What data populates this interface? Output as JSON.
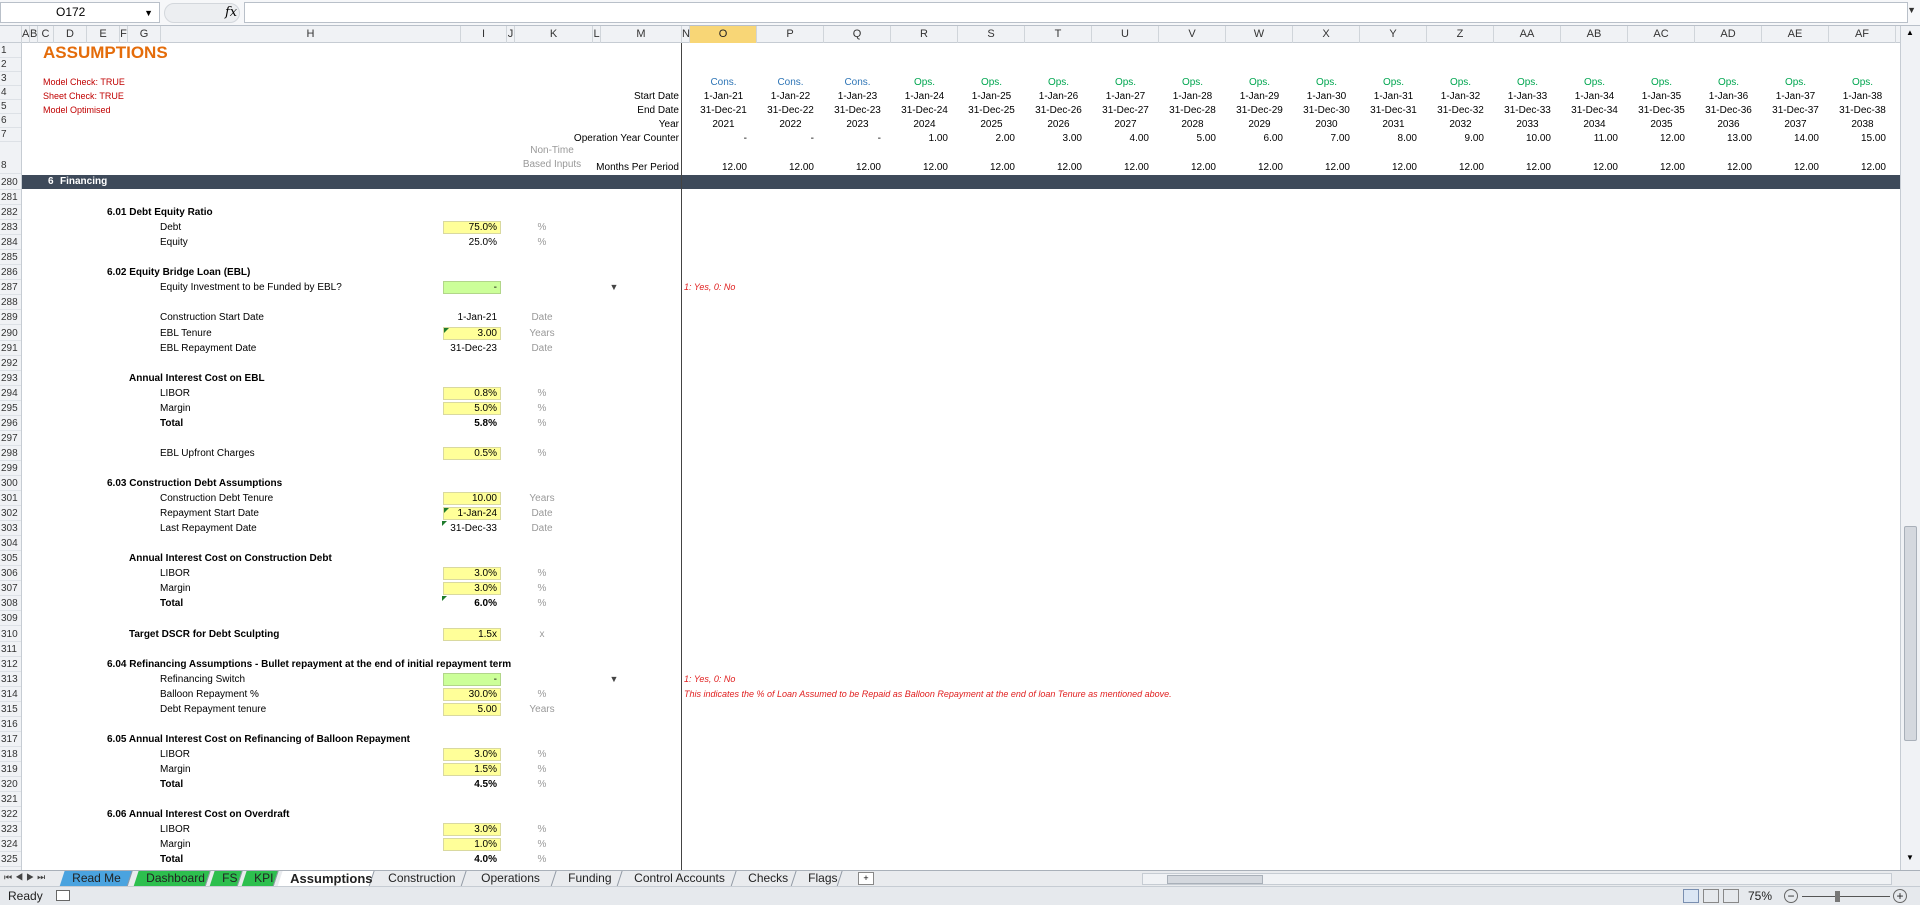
{
  "name_box": "O172",
  "fx_label": "fx",
  "columns": [
    "A",
    "B",
    "C",
    "D",
    "E",
    "F",
    "G",
    "H",
    "I",
    "J",
    "K",
    "L",
    "M",
    "N",
    "O",
    "P",
    "Q",
    "R",
    "S",
    "T",
    "U",
    "V",
    "W",
    "X",
    "Y",
    "Z",
    "AA",
    "AB",
    "AC",
    "AD",
    "AE",
    "AF"
  ],
  "selected_column": "O",
  "row_numbers": [
    "1",
    "2",
    "3",
    "4",
    "5",
    "6",
    "7",
    "8",
    "280",
    "281",
    "282",
    "283",
    "284",
    "285",
    "286",
    "287",
    "288",
    "289",
    "290",
    "291",
    "292",
    "293",
    "294",
    "295",
    "296",
    "297",
    "298",
    "299",
    "300",
    "301",
    "302",
    "303",
    "304",
    "305",
    "306",
    "307",
    "308",
    "309",
    "310",
    "311",
    "312",
    "313",
    "314",
    "315",
    "316",
    "317",
    "318",
    "319",
    "320",
    "321",
    "322",
    "323",
    "324",
    "325"
  ],
  "header": {
    "title": "ASSUMPTIONS",
    "model_check": "Model Check: TRUE",
    "sheet_check": "Sheet Check: TRUE",
    "model_optimised": "Model Optimised",
    "start_date_label": "Start Date",
    "end_date_label": "End Date",
    "year_label": "Year",
    "op_counter_label": "Operation Year Counter",
    "non_time_1": "Non-Time",
    "non_time_2": "Based Inputs",
    "months_label": "Months Per Period"
  },
  "timeline": {
    "phase": [
      "Cons.",
      "Cons.",
      "Cons.",
      "Ops.",
      "Ops.",
      "Ops.",
      "Ops.",
      "Ops.",
      "Ops.",
      "Ops.",
      "Ops.",
      "Ops.",
      "Ops.",
      "Ops.",
      "Ops.",
      "Ops.",
      "Ops.",
      "Ops."
    ],
    "start": [
      "1-Jan-21",
      "1-Jan-22",
      "1-Jan-23",
      "1-Jan-24",
      "1-Jan-25",
      "1-Jan-26",
      "1-Jan-27",
      "1-Jan-28",
      "1-Jan-29",
      "1-Jan-30",
      "1-Jan-31",
      "1-Jan-32",
      "1-Jan-33",
      "1-Jan-34",
      "1-Jan-35",
      "1-Jan-36",
      "1-Jan-37",
      "1-Jan-38"
    ],
    "end": [
      "31-Dec-21",
      "31-Dec-22",
      "31-Dec-23",
      "31-Dec-24",
      "31-Dec-25",
      "31-Dec-26",
      "31-Dec-27",
      "31-Dec-28",
      "31-Dec-29",
      "31-Dec-30",
      "31-Dec-31",
      "31-Dec-32",
      "31-Dec-33",
      "31-Dec-34",
      "31-Dec-35",
      "31-Dec-36",
      "31-Dec-37",
      "31-Dec-38"
    ],
    "year": [
      "2021",
      "2022",
      "2023",
      "2024",
      "2025",
      "2026",
      "2027",
      "2028",
      "2029",
      "2030",
      "2031",
      "2032",
      "2033",
      "2034",
      "2035",
      "2036",
      "2037",
      "2038"
    ],
    "counter": [
      "-",
      "-",
      "-",
      "1.00",
      "2.00",
      "3.00",
      "4.00",
      "5.00",
      "6.00",
      "7.00",
      "8.00",
      "9.00",
      "10.00",
      "11.00",
      "12.00",
      "13.00",
      "14.00",
      "15.00"
    ],
    "months": [
      "12.00",
      "12.00",
      "12.00",
      "12.00",
      "12.00",
      "12.00",
      "12.00",
      "12.00",
      "12.00",
      "12.00",
      "12.00",
      "12.00",
      "12.00",
      "12.00",
      "12.00",
      "12.00",
      "12.00",
      "12.00"
    ]
  },
  "section": {
    "num": "6",
    "title": "Financing"
  },
  "body": {
    "s601": "6.01  Debt Equity Ratio",
    "debt": "Debt",
    "debt_val": "75.0%",
    "debt_unit": "%",
    "equity": "Equity",
    "equity_val": "25.0%",
    "equity_unit": "%",
    "s602": "6.02  Equity Bridge Loan (EBL)",
    "ebl_q": "Equity Investment to be Funded by EBL?",
    "ebl_q_val": "-",
    "ebl_q_note": "1: Yes, 0: No",
    "cons_start": "Construction Start Date",
    "cons_start_val": "1-Jan-21",
    "cons_start_unit": "Date",
    "ebl_tenure": "EBL Tenure",
    "ebl_tenure_val": "3.00",
    "ebl_tenure_unit": "Years",
    "ebl_repay": "EBL Repayment Date",
    "ebl_repay_val": "31-Dec-23",
    "ebl_repay_unit": "Date",
    "aic_ebl": "Annual Interest Cost on EBL",
    "libor1": "LIBOR",
    "libor1_val": "0.8%",
    "libor1_unit": "%",
    "margin1": "Margin",
    "margin1_val": "5.0%",
    "margin1_unit": "%",
    "total1": "Total",
    "total1_val": "5.8%",
    "total1_unit": "%",
    "ebl_upfront": "EBL Upfront Charges",
    "ebl_upfront_val": "0.5%",
    "ebl_upfront_unit": "%",
    "s603": "6.03  Construction Debt Assumptions",
    "cd_tenure": "Construction Debt Tenure",
    "cd_tenure_val": "10.00",
    "cd_tenure_unit": "Years",
    "repay_start": "Repayment Start Date",
    "repay_start_val": "1-Jan-24",
    "repay_start_unit": "Date",
    "last_repay": "Last Repayment Date",
    "last_repay_val": "31-Dec-33",
    "last_repay_unit": "Date",
    "aic_cd": "Annual Interest Cost on Construction Debt",
    "libor2": "LIBOR",
    "libor2_val": "3.0%",
    "libor2_unit": "%",
    "margin2": "Margin",
    "margin2_val": "3.0%",
    "margin2_unit": "%",
    "total2": "Total",
    "total2_val": "6.0%",
    "total2_unit": "%",
    "dscr": "Target DSCR for Debt Sculpting",
    "dscr_val": "1.5x",
    "dscr_unit": "x",
    "s604": "6.04  Refinancing Assumptions - Bullet repayment at the end of initial repayment term",
    "refi_switch": "Refinancing  Switch",
    "refi_switch_val": "-",
    "refi_switch_note": "1: Yes, 0: No",
    "balloon": "Balloon Repayment %",
    "balloon_val": "30.0%",
    "balloon_unit": "%",
    "balloon_note": "This indicates the % of Loan Assumed to be Repaid as Balloon Repayment at the end of loan Tenure as mentioned above.",
    "debt_tenure": "Debt Repayment tenure",
    "debt_tenure_val": "5.00",
    "debt_tenure_unit": "Years",
    "s605": "6.05  Annual Interest Cost on Refinancing of Balloon Repayment",
    "libor3": "LIBOR",
    "libor3_val": "3.0%",
    "libor3_unit": "%",
    "margin3": "Margin",
    "margin3_val": "1.5%",
    "margin3_unit": "%",
    "total3": "Total",
    "total3_val": "4.5%",
    "total3_unit": "%",
    "s606": "6.06  Annual Interest Cost on Overdraft",
    "libor4": "LIBOR",
    "libor4_val": "3.0%",
    "libor4_unit": "%",
    "margin4": "Margin",
    "margin4_val": "1.0%",
    "margin4_unit": "%",
    "total4": "Total",
    "total4_val": "4.0%",
    "total4_unit": "%"
  },
  "tabs": [
    {
      "label": "Read Me",
      "color": "#4aa3df"
    },
    {
      "label": "Dashboard",
      "color": "#2dbf4e"
    },
    {
      "label": "FS",
      "color": "#2dbf4e"
    },
    {
      "label": "KPI",
      "color": "#2dbf4e"
    },
    {
      "label": "Assumptions",
      "color": "#ffffff"
    },
    {
      "label": "Construction",
      "color": "#e9ebee"
    },
    {
      "label": "Operations",
      "color": "#e9ebee"
    },
    {
      "label": "Funding",
      "color": "#e9ebee"
    },
    {
      "label": "Control Accounts",
      "color": "#e9ebee"
    },
    {
      "label": "Checks",
      "color": "#e9ebee"
    },
    {
      "label": "Flags",
      "color": "#e9ebee"
    }
  ],
  "status": {
    "ready": "Ready",
    "zoom": "75%"
  },
  "colors": {
    "title": "#e46c0a",
    "check": "#c00000",
    "cons": "#2e75b6",
    "ops": "#00a650",
    "note": "#e02020",
    "section_bg": "#3e4a5a",
    "input_yellow": "#ffff99",
    "input_green": "#ccff99"
  }
}
